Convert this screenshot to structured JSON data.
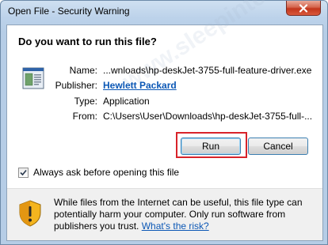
{
  "window": {
    "title": "Open File - Security Warning",
    "close_icon": "close-icon"
  },
  "dialog": {
    "heading": "Do you want to run this file?",
    "file_icon": "executable-file-icon",
    "fields": {
      "name_label": "Name:",
      "name_value": "...wnloads\\hp-deskJet-3755-full-feature-driver.exe",
      "publisher_label": "Publisher:",
      "publisher_value": "Hewlett Packard",
      "type_label": "Type:",
      "type_value": "Application",
      "from_label": "From:",
      "from_value": "C:\\Users\\User\\Downloads\\hp-deskJet-3755-full-..."
    },
    "buttons": {
      "run": "Run",
      "cancel": "Cancel"
    },
    "checkbox": {
      "label": "Always ask before opening this file",
      "checked": true
    }
  },
  "footer": {
    "shield_icon": "warning-shield-icon",
    "warning_text": "While files from the Internet can be useful, this file type can potentially harm your computer. Only run software from publishers you trust.",
    "link_text": "What's the risk?"
  },
  "watermark": {
    "text": "www.sleepinterdriverdownload.com"
  },
  "colors": {
    "link": "#0b57b5",
    "highlight_frame": "#d8232a",
    "window_frame": "#b6cde6"
  }
}
